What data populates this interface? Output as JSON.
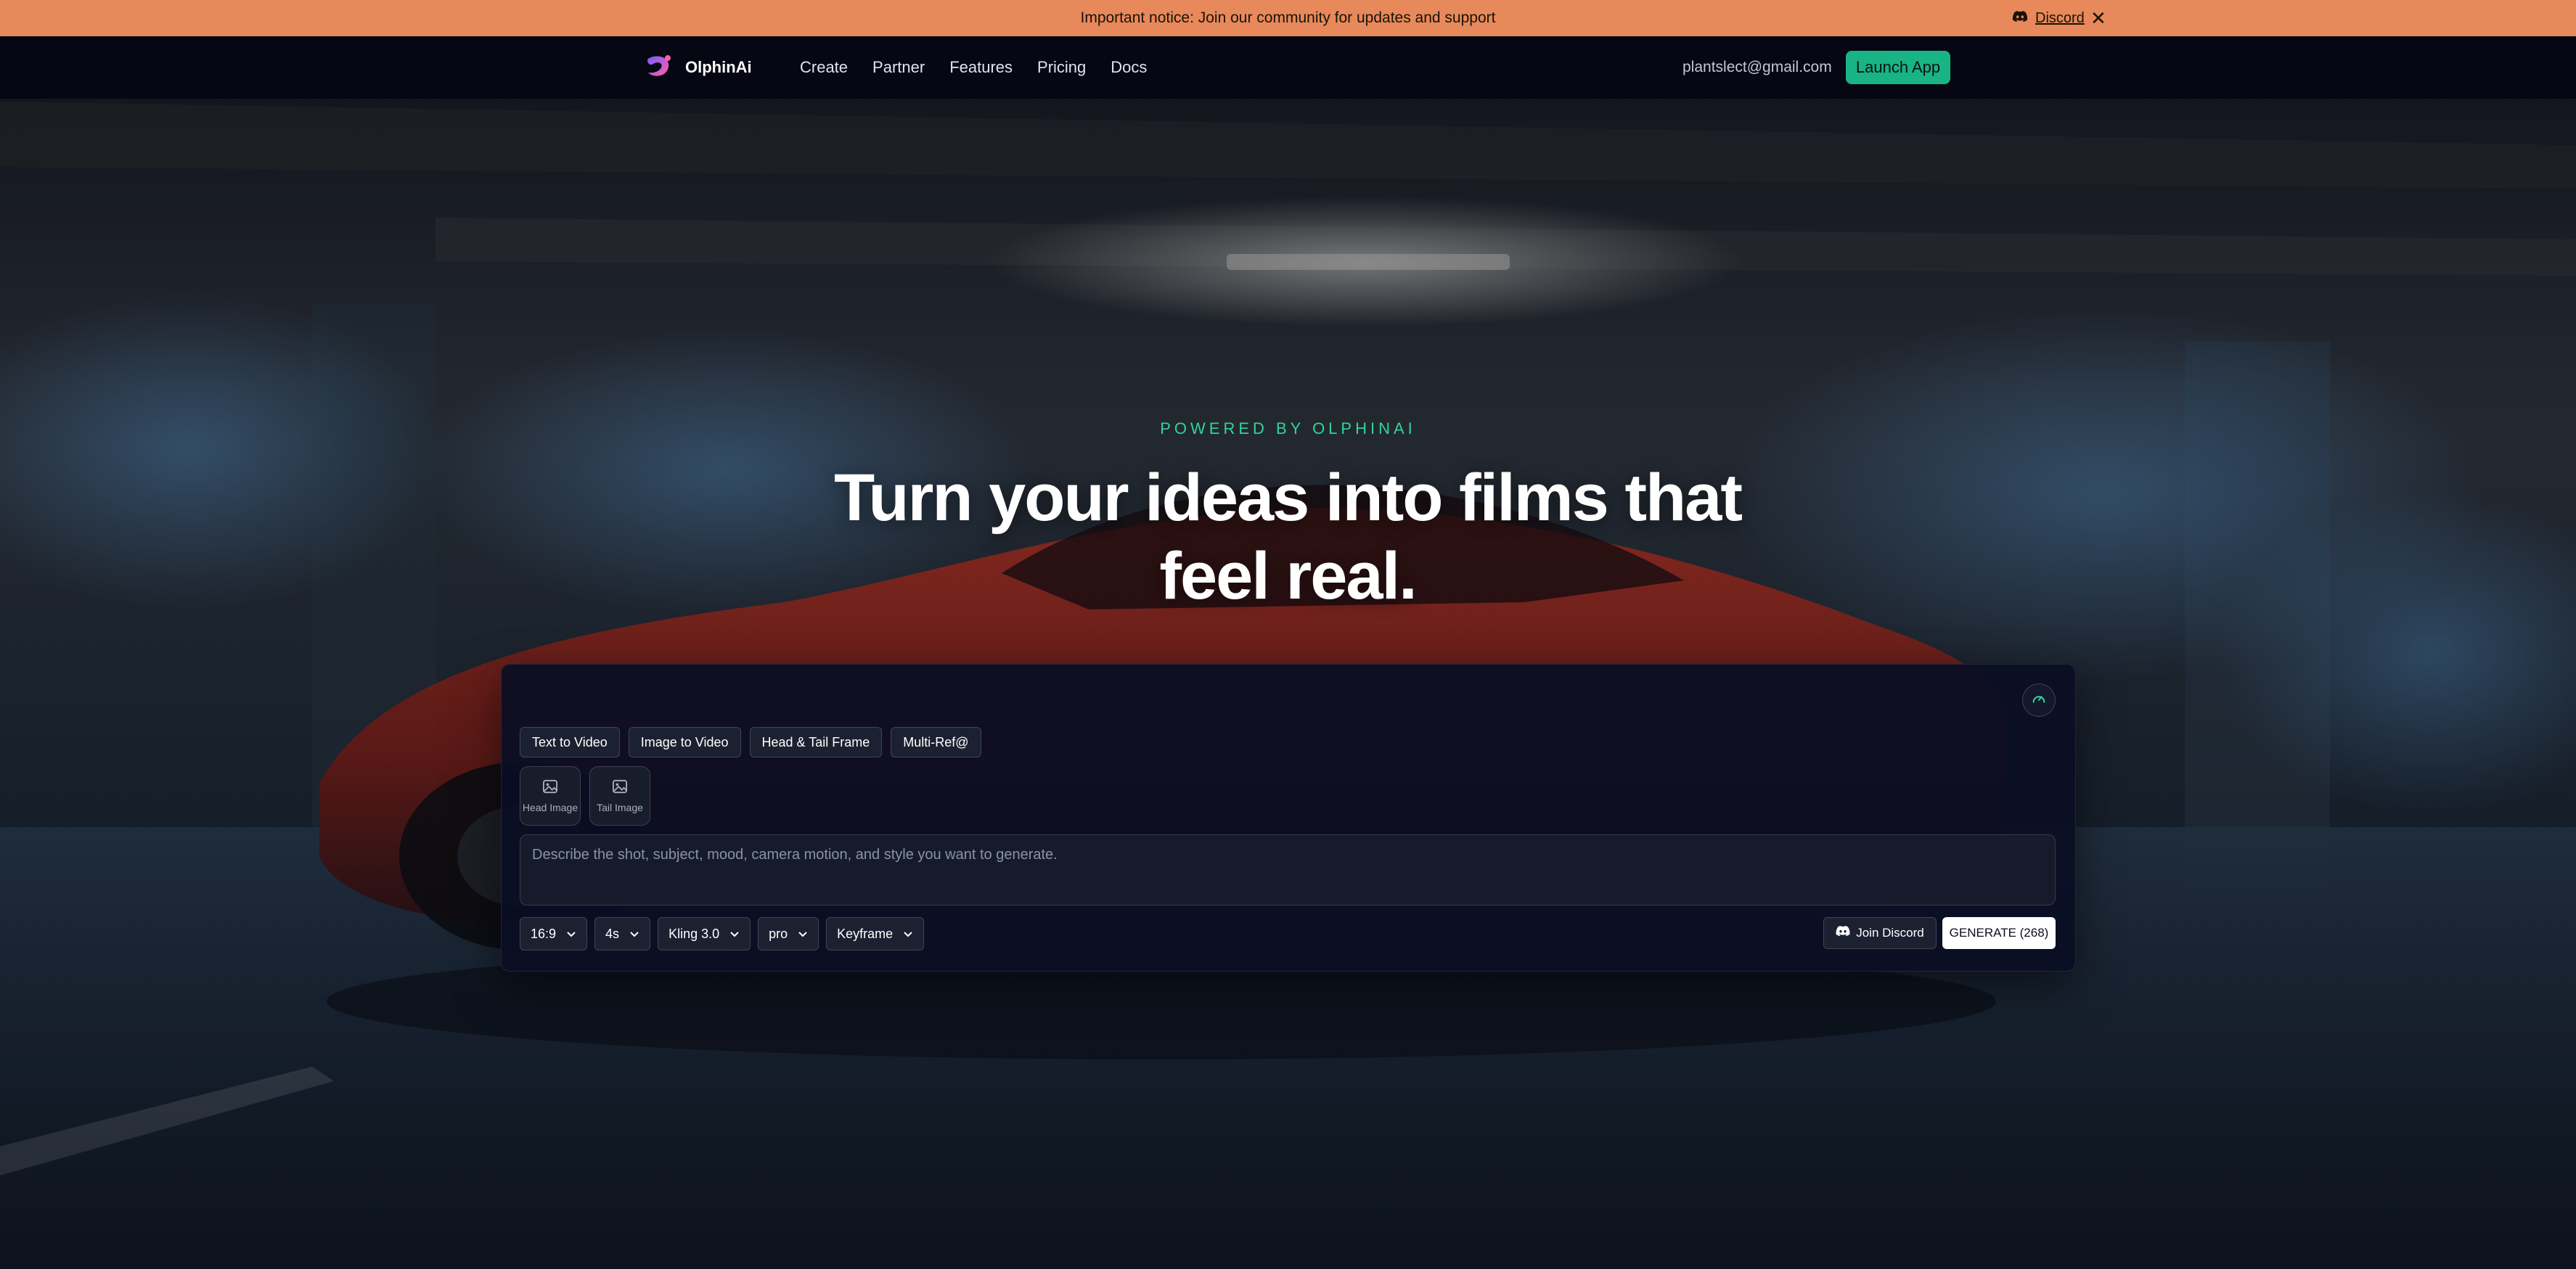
{
  "notice": {
    "text": "Important notice: Join our community for updates and support",
    "link_label": "Discord",
    "close_glyph": "✕",
    "background": "#e7895a"
  },
  "nav": {
    "brand": "OlphinAi",
    "items": [
      {
        "label": "Create"
      },
      {
        "label": "Partner"
      },
      {
        "label": "Features"
      },
      {
        "label": "Pricing"
      },
      {
        "label": "Docs"
      }
    ],
    "user_email": "plantslect@gmail.com",
    "launch_label": "Launch App",
    "accent": "#19b486"
  },
  "hero": {
    "kicker": "POWERED BY OLPHINAI",
    "headline": "Turn your ideas into films that feel real.",
    "kicker_color": "#2fd59a"
  },
  "composer": {
    "mode_tabs": [
      {
        "label": "Text to Video"
      },
      {
        "label": "Image to Video"
      },
      {
        "label": "Head & Tail Frame"
      },
      {
        "label": "Multi-Ref@"
      }
    ],
    "uploads": [
      {
        "label": "Head Image",
        "icon": "image-icon"
      },
      {
        "label": "Tail Image",
        "icon": "image-icon"
      }
    ],
    "prompt_placeholder": "Describe the shot, subject, mood, camera motion, and style you want to generate.",
    "prompt_value": "",
    "selects": {
      "aspect": "16:9",
      "duration": "4s",
      "model": "Kling 3.0",
      "quality": "pro",
      "mode": "Keyframe"
    },
    "join_label": "Join Discord",
    "generate_label": "GENERATE (268)"
  }
}
